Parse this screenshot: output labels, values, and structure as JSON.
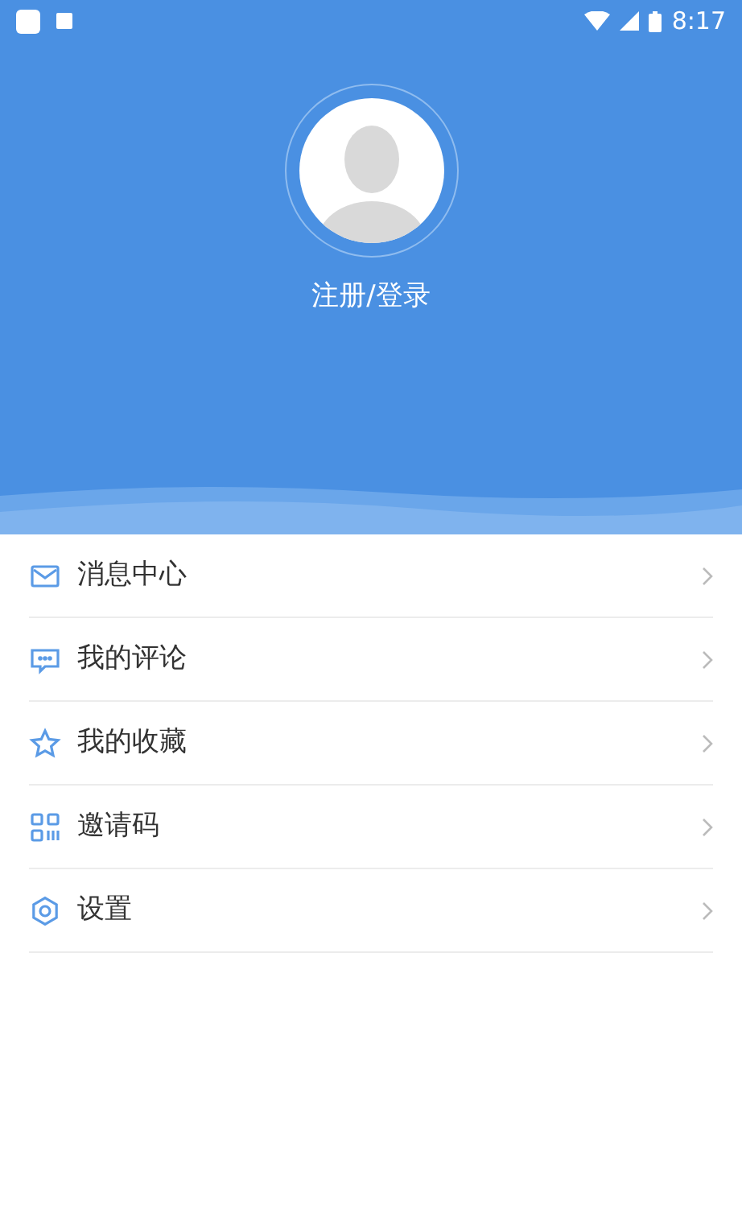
{
  "status_bar": {
    "time": "8:17"
  },
  "profile": {
    "login_label": "注册/登录"
  },
  "menu": [
    {
      "kind": "mail",
      "label": "消息中心"
    },
    {
      "kind": "comment",
      "label": "我的评论"
    },
    {
      "kind": "star",
      "label": "我的收藏"
    },
    {
      "kind": "qr",
      "label": "邀请码"
    },
    {
      "kind": "gear",
      "label": "设置"
    }
  ]
}
